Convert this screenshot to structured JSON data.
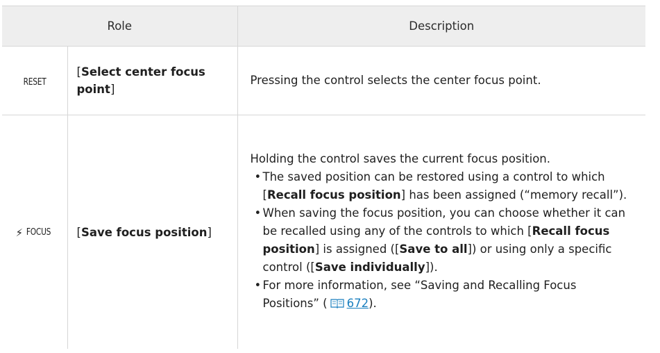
{
  "table": {
    "headers": {
      "role": "Role",
      "description": "Description"
    },
    "rows": [
      {
        "icon_name": "reset-button-icon",
        "icon_text": "RESET",
        "role_name": "Select center focus point",
        "description": "Pressing the control selects the center focus point."
      },
      {
        "icon_name": "save-focus-button-icon",
        "icon_text": "FOCUS",
        "role_name": "Save focus position",
        "intro": "Holding the control saves the current focus position.",
        "bullet1": {
          "text1": "The saved position can be restored using a control to which [",
          "bold1": "Recall focus position",
          "text2": "] has been assigned (“memory recall”)."
        },
        "bullet2": {
          "text1": "When saving the focus position, you can choose whether it can be recalled using any of the controls to which [",
          "bold1": "Recall focus position",
          "text2": "] is assigned ([",
          "bold2": "Save to all",
          "text3": "]) or using only a specific control ([",
          "bold3": "Save individually",
          "text4": "])."
        },
        "bullet3": {
          "text1": "For more information, see “Saving and Recalling Focus Positions” (",
          "page_ref": "672",
          "text2": ")."
        }
      }
    ]
  },
  "colors": {
    "header_bg": "#eeeeee",
    "border": "#d6d6d6",
    "link": "#1a7fbf",
    "text": "#1f1f1f"
  }
}
